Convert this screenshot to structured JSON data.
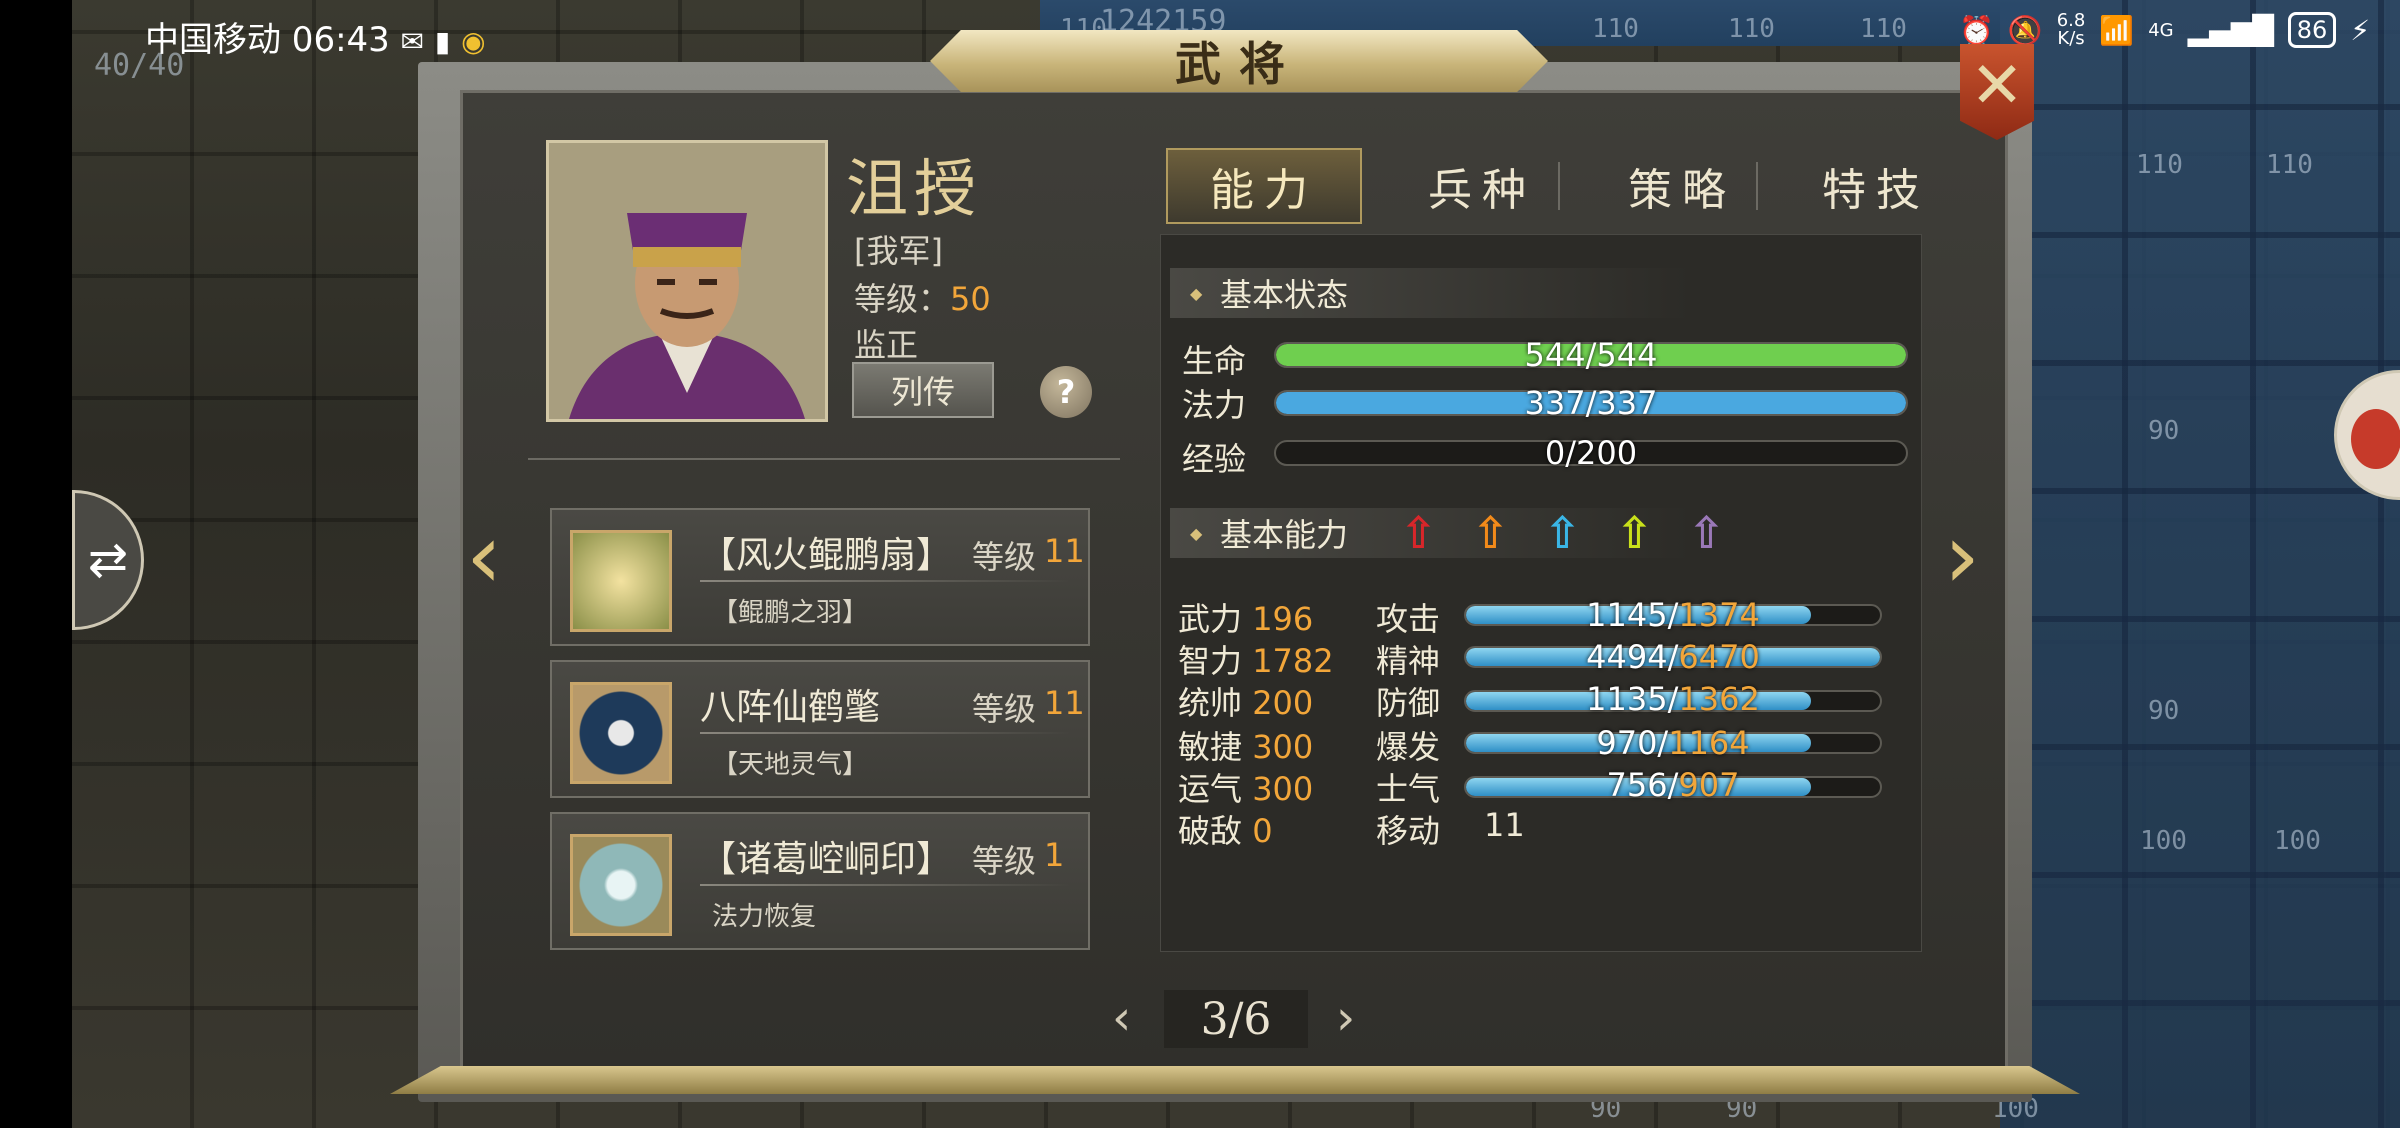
{
  "status_bar": {
    "carrier_time": "中国移动 06:43",
    "net_speed_value": "6.8",
    "net_speed_unit": "K/s",
    "network": "4G",
    "battery": "86",
    "icons": [
      "mail-icon",
      "sim-icon",
      "weibo-icon",
      "alarm-icon",
      "mute-icon",
      "wifi-icon",
      "signal-icon",
      "charging-icon"
    ]
  },
  "map": {
    "counter": "40/40",
    "top_number": "1242159",
    "tile_numbers": [
      "110",
      "110",
      "110",
      "110",
      "110",
      "110",
      "90",
      "90",
      "100",
      "100",
      "90",
      "90",
      "100"
    ]
  },
  "dialog": {
    "title": "武将",
    "close_icon": "close-icon"
  },
  "hero": {
    "name": "沮授",
    "faction": "[我军]",
    "level_label": "等级：",
    "level": "50",
    "class": "监正",
    "biography_button": "列传",
    "help_button": "?"
  },
  "equipment": [
    {
      "name": "【风火鲲鹏扇】",
      "level_label": "等级",
      "level": "11",
      "sub": "【鲲鹏之羽】",
      "icon": "fan-icon",
      "icon_color": "#d8c45a"
    },
    {
      "name": "八阵仙鹤氅",
      "level_label": "等级",
      "level": "11",
      "sub": "【天地灵气】",
      "icon": "cloak-icon",
      "icon_color": "#1e3a5a"
    },
    {
      "name": "【诸葛崆峒印】",
      "level_label": "等级",
      "level": "1",
      "sub": "法力恢复",
      "icon": "seal-icon",
      "icon_color": "#8fb8b8"
    }
  ],
  "tabs": [
    {
      "label": "能力",
      "active": true
    },
    {
      "label": "兵种",
      "active": false
    },
    {
      "label": "策略",
      "active": false
    },
    {
      "label": "特技",
      "active": false
    }
  ],
  "basic_status": {
    "header": "基本状态",
    "bars": [
      {
        "label": "生命",
        "text": "544/544",
        "fill": 1.0,
        "color": "#6fcf4f"
      },
      {
        "label": "法力",
        "text": "337/337",
        "fill": 1.0,
        "color": "#4aa8e0"
      },
      {
        "label": "经验",
        "text": "0/200",
        "fill": 0.0,
        "color": "#d9c07a"
      }
    ]
  },
  "basic_ability": {
    "header": "基本能力",
    "arrow_colors": [
      "#d8262a",
      "#f28a1a",
      "#3ab6e6",
      "#c8e01a",
      "#9a78b8"
    ],
    "attributes": [
      {
        "label": "武力",
        "value": "196"
      },
      {
        "label": "智力",
        "value": "1782"
      },
      {
        "label": "统帅",
        "value": "200"
      },
      {
        "label": "敏捷",
        "value": "300"
      },
      {
        "label": "运气",
        "value": "300"
      },
      {
        "label": "破敌",
        "value": "0"
      }
    ],
    "stats": [
      {
        "label": "攻击",
        "current": "1145",
        "max": "1374",
        "fill": 0.833
      },
      {
        "label": "精神",
        "current": "4494",
        "max": "6470",
        "fill": 1.0
      },
      {
        "label": "防御",
        "current": "1135",
        "max": "1362",
        "fill": 0.833
      },
      {
        "label": "爆发",
        "current": "970",
        "max": "1164",
        "fill": 0.833
      },
      {
        "label": "士气",
        "current": "756",
        "max": "907",
        "fill": 0.833
      }
    ],
    "move_label": "移动",
    "move_value": "11"
  },
  "pager": {
    "text": "3/6",
    "prev": "‹",
    "next": "›"
  }
}
